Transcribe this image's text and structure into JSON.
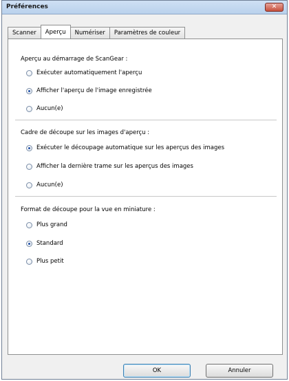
{
  "window": {
    "title": "Préférences",
    "close_glyph": "✕"
  },
  "tabs": [
    {
      "label": "Scanner",
      "active": false
    },
    {
      "label": "Aperçu",
      "active": true
    },
    {
      "label": "Numériser",
      "active": false
    },
    {
      "label": "Paramètres de couleur",
      "active": false
    }
  ],
  "groups": [
    {
      "title": "Aperçu au démarrage de ScanGear :",
      "options": [
        {
          "label": "Exécuter automatiquement l'aperçu",
          "checked": false
        },
        {
          "label": "Afficher l'aperçu de l'image enregistrée",
          "checked": true
        },
        {
          "label": "Aucun(e)",
          "checked": false
        }
      ]
    },
    {
      "title": "Cadre de découpe sur les images d'aperçu :",
      "options": [
        {
          "label": "Exécuter le découpage automatique sur les aperçus des images",
          "checked": true
        },
        {
          "label": "Afficher la dernière trame sur les aperçus des images",
          "checked": false
        },
        {
          "label": "Aucun(e)",
          "checked": false
        }
      ]
    },
    {
      "title": "Format de découpe pour la vue en miniature :",
      "options": [
        {
          "label": "Plus grand",
          "checked": false
        },
        {
          "label": "Standard",
          "checked": true
        },
        {
          "label": "Plus petit",
          "checked": false
        }
      ]
    }
  ],
  "buttons": {
    "ok": "OK",
    "cancel": "Annuler"
  }
}
